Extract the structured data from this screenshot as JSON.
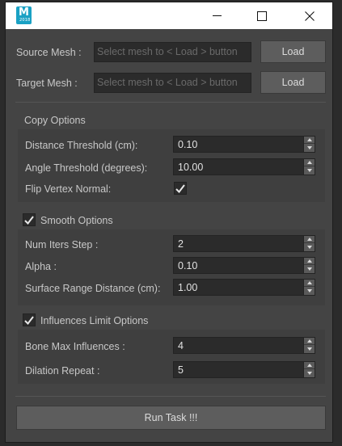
{
  "window": {
    "app_icon_letter": "M",
    "app_icon_sub": "2018"
  },
  "mesh": {
    "source_label": "Source Mesh :",
    "target_label": "Target Mesh :",
    "source_placeholder": "Select mesh to < Load > button",
    "target_placeholder": "Select mesh to < Load > button",
    "load_label": "Load"
  },
  "copy_options": {
    "title": "Copy Options",
    "distance_label": "Distance Threshold (cm):",
    "distance_value": "0.10",
    "angle_label": "Angle Threshold (degrees):",
    "angle_value": "10.00",
    "flip_label": "Flip Vertex Normal:",
    "flip_checked": true
  },
  "smooth_options": {
    "title": "Smooth Options",
    "enabled": true,
    "iters_label": "Num Iters Step :",
    "iters_value": "2",
    "alpha_label": "Alpha :",
    "alpha_value": "0.10",
    "range_label": "Surface Range Distance (cm):",
    "range_value": "1.00"
  },
  "influence_options": {
    "title": "Influences Limit Options",
    "enabled": true,
    "bone_label": "Bone Max Influences :",
    "bone_value": "4",
    "dilation_label": "Dilation Repeat :",
    "dilation_value": "5"
  },
  "run_label": "Run Task !!!"
}
